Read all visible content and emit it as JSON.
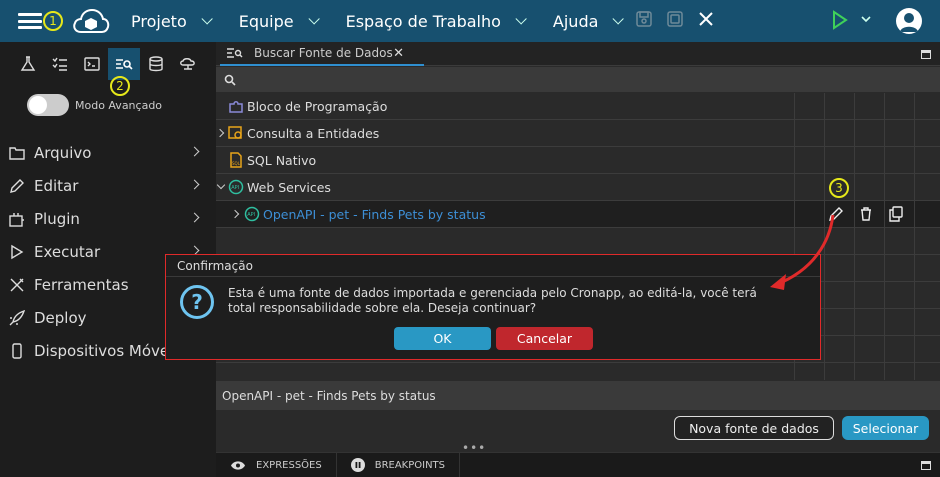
{
  "topbar": {
    "badge1": "1",
    "menus": [
      "Projeto",
      "Equipe",
      "Espaço de Trabalho",
      "Ajuda"
    ]
  },
  "toolbar": {
    "badge2": "2"
  },
  "left": {
    "toggle_label": "Modo Avançado",
    "nav": [
      "Arquivo",
      "Editar",
      "Plugin",
      "Executar",
      "Ferramentas",
      "Deploy",
      "Dispositivos Móve"
    ]
  },
  "tab": {
    "title": "Buscar Fonte de Dados",
    "close": "✕"
  },
  "tree": [
    {
      "label": "Bloco de Programação",
      "icon": "puzzle-icon"
    },
    {
      "label": "Consulta a Entidades",
      "icon": "query-icon"
    },
    {
      "label": "SQL Nativo",
      "icon": "sql-file-icon"
    },
    {
      "label": "Web Services",
      "icon": "api-icon"
    },
    {
      "label": "OpenAPI - pet - Finds Pets by status",
      "icon": "api-icon"
    }
  ],
  "row_actions": {
    "badge3": "3"
  },
  "selected_text": "OpenAPI - pet - Finds Pets by status",
  "buttons": {
    "new": "Nova fonte de dados",
    "select": "Selecionar"
  },
  "bottom_tabs": [
    "EXPRESSÕES",
    "BREAKPOINTS"
  ],
  "bottom_dots": "•••",
  "dialog": {
    "title": "Confirmação",
    "message": "Esta é uma fonte de dados importada e gerenciada pelo Cronapp, ao editá-la, você terá total responsabilidade sobre ela. Deseja continuar?",
    "ok": "OK",
    "cancel": "Cancelar",
    "icon_glyph": "?"
  },
  "colors": {
    "topbar": "#17506f",
    "accent": "#2998c4",
    "danger": "#c0272d",
    "annotation": "#e02a2a",
    "badge": "#e6e81a"
  }
}
